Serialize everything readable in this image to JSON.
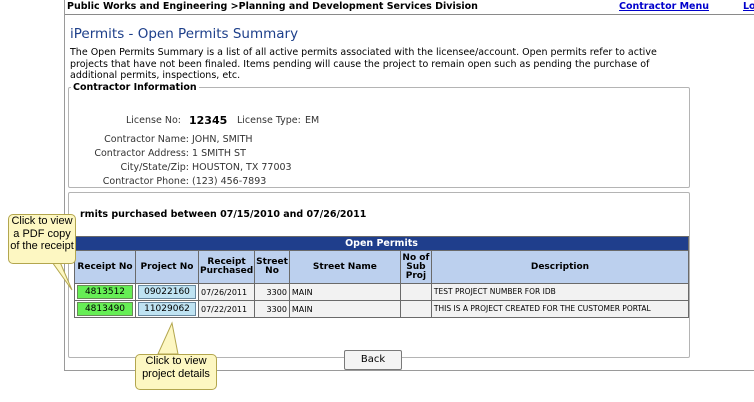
{
  "header": {
    "breadcrumb": "Public Works and Engineering >Planning and Development Services Division",
    "contractor_menu": "Contractor Menu",
    "cut_link": "Lo"
  },
  "page_title": "iPermits - Open Permits Summary",
  "intro": "The Open Permits Summary is a list of all active permits associated with the licensee/account. Open permits refer to active projects that have not been finaled. Items pending will cause the project to remain open such as pending the purchase of additional permits, inspections, etc.",
  "contractor": {
    "legend": "Contractor Information",
    "license_no_label": "License No:",
    "license_no": "12345",
    "license_type_label": "License Type:",
    "license_type": "EM",
    "name_label": "Contractor Name:",
    "name": "JOHN, SMITH",
    "address_label": "Contractor Address:",
    "address": "1 SMITH ST",
    "city_label": "City/State/Zip:",
    "city": "HOUSTON, TX  77003",
    "phone_label": "Contractor Phone:",
    "phone": "(123) 456-7893"
  },
  "permits": {
    "period_text": "rmits purchased between 07/15/2010 and 07/26/2011",
    "table_title": "Open Permits",
    "columns": [
      "Receipt No",
      "Project No",
      "Receipt Purchased",
      "Street No",
      "Street Name",
      "No of Sub Proj",
      "Description"
    ],
    "rows": [
      {
        "receipt_no": "4813512",
        "project_no": "09022160",
        "purchased": "07/26/2011",
        "street_no": "3300",
        "street_name": "MAIN",
        "sub_proj": "",
        "description": "TEST PROJECT NUMBER FOR IDB"
      },
      {
        "receipt_no": "4813490",
        "project_no": "11029062",
        "purchased": "07/22/2011",
        "street_no": "3300",
        "street_name": "MAIN",
        "sub_proj": "",
        "description": "THIS IS A PROJECT CREATED FOR THE CUSTOMER PORTAL"
      }
    ]
  },
  "back_button": "Back",
  "callouts": {
    "receipt": "Click to view a PDF copy of the receipt",
    "project": "Click to view project details"
  }
}
